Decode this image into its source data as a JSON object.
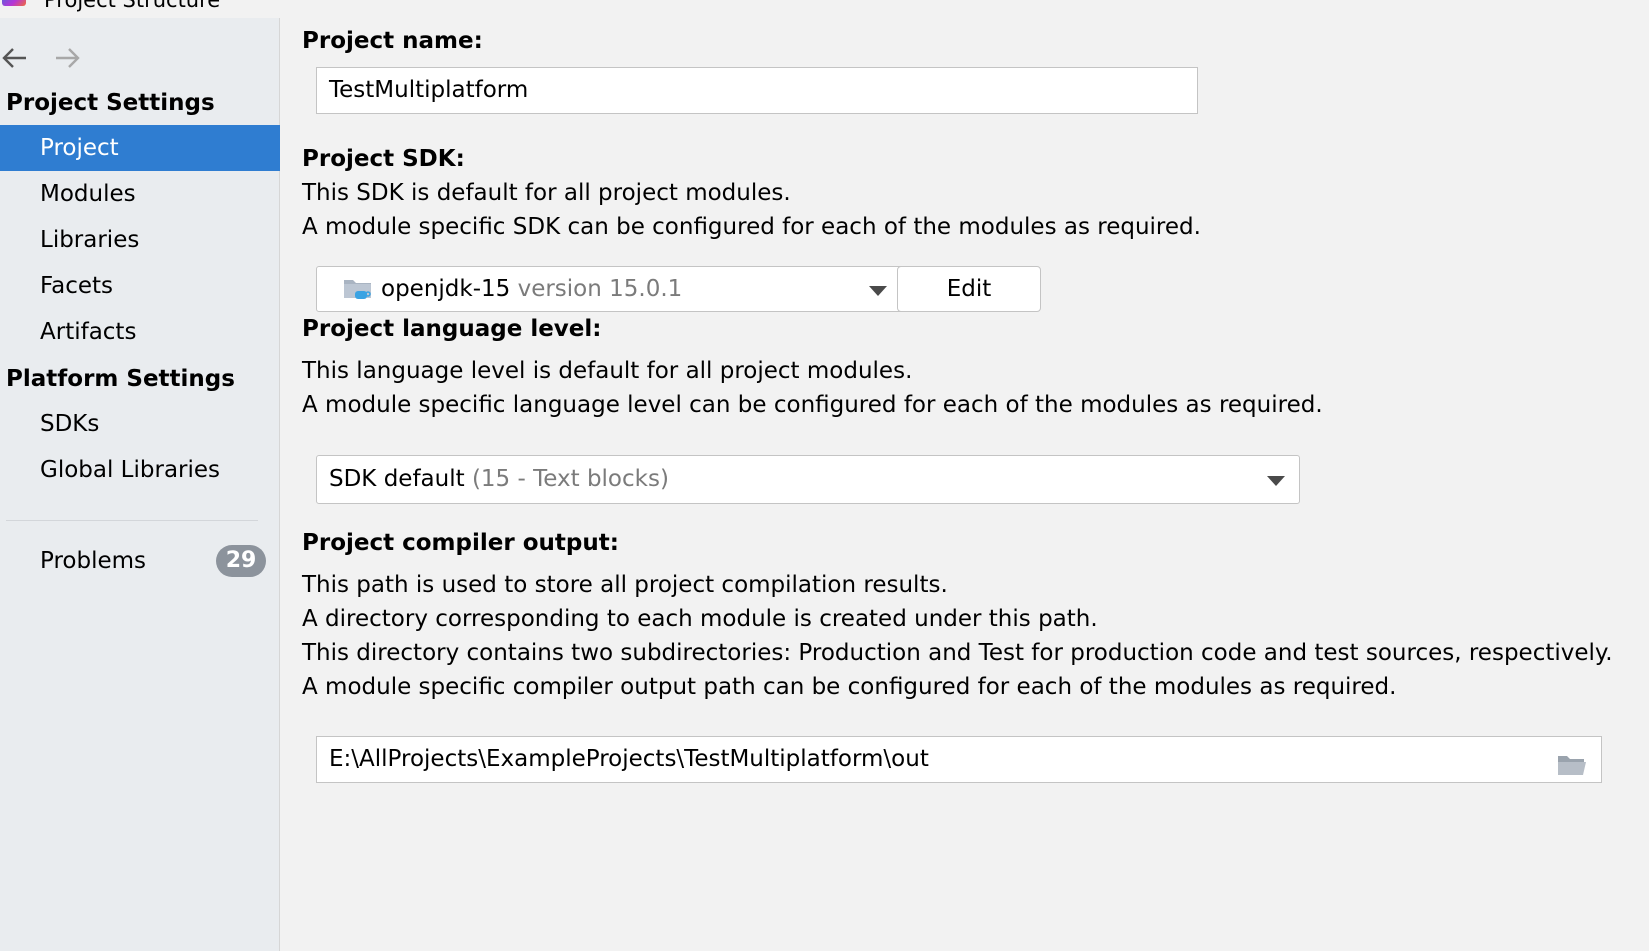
{
  "window": {
    "title": "Project Structure"
  },
  "sidebar": {
    "project_settings_title": "Project Settings",
    "project_items": [
      {
        "label": "Project",
        "selected": true
      },
      {
        "label": "Modules"
      },
      {
        "label": "Libraries"
      },
      {
        "label": "Facets"
      },
      {
        "label": "Artifacts"
      }
    ],
    "platform_settings_title": "Platform Settings",
    "platform_items": [
      {
        "label": "SDKs"
      },
      {
        "label": "Global Libraries"
      }
    ],
    "problems": {
      "label": "Problems",
      "count": "29"
    }
  },
  "main": {
    "project_name": {
      "label": "Project name:",
      "value": "TestMultiplatform"
    },
    "sdk": {
      "label": "Project SDK:",
      "desc1": "This SDK is default for all project modules.",
      "desc2": "A module specific SDK can be configured for each of the modules as required.",
      "selected_name": "openjdk-15",
      "selected_version": "version 15.0.1",
      "edit_label": "Edit"
    },
    "language_level": {
      "label": "Project language level:",
      "desc1": "This language level is default for all project modules.",
      "desc2": "A module specific language level can be configured for each of the modules as required.",
      "selected": "SDK default",
      "selected_detail": "(15 - Text blocks)"
    },
    "compiler_output": {
      "label": "Project compiler output:",
      "desc1": "This path is used to store all project compilation results.",
      "desc2": "A directory corresponding to each module is created under this path.",
      "desc3": "This directory contains two subdirectories: Production and Test for production code and test sources, respectively.",
      "desc4": "A module specific compiler output path can be configured for each of the modules as required.",
      "path": "E:\\AllProjects\\ExampleProjects\\TestMultiplatform\\out"
    }
  },
  "colors": {
    "selection": "#2f7dd1",
    "sidebar_bg": "#e9ecef",
    "content_bg": "#f2f2f2",
    "badge_bg": "#8c939c"
  },
  "icons": {
    "back": "arrow-left-icon",
    "forward": "arrow-right-icon",
    "sdk": "jdk-folder-icon",
    "browse": "folder-icon"
  }
}
